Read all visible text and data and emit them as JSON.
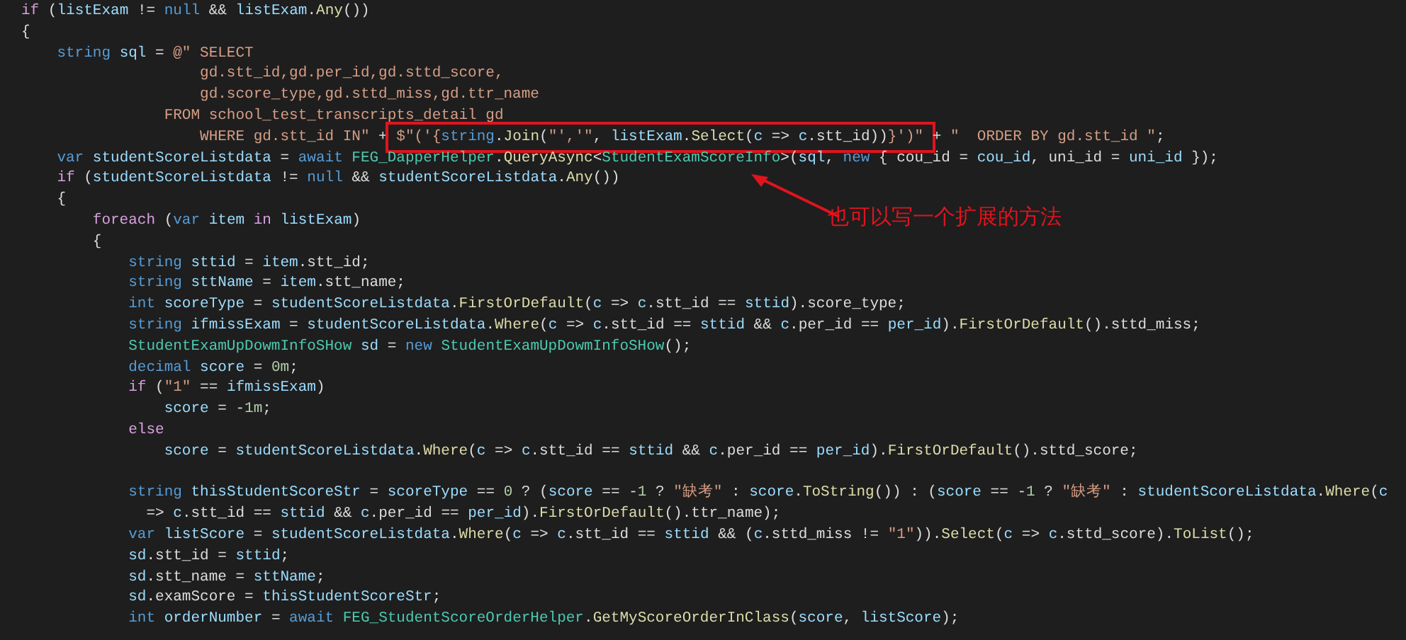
{
  "code_lines": [
    {
      "kind": "code",
      "tokens": [
        {
          "kind": "ctl",
          "t": "if"
        },
        {
          "kind": "p",
          "t": " ("
        },
        {
          "kind": "id",
          "t": "listExam"
        },
        {
          "kind": "p",
          "t": " != "
        },
        {
          "kind": "kw",
          "t": "null"
        },
        {
          "kind": "p",
          "t": " && "
        },
        {
          "kind": "id",
          "t": "listExam"
        },
        {
          "kind": "p",
          "t": "."
        },
        {
          "kind": "fn",
          "t": "Any"
        },
        {
          "kind": "p",
          "t": "())"
        }
      ]
    },
    {
      "kind": "code",
      "tokens": [
        {
          "kind": "p",
          "t": "{"
        }
      ]
    },
    {
      "kind": "code",
      "tokens": [
        {
          "kind": "kw",
          "t": "    string "
        },
        {
          "kind": "id",
          "t": "sql"
        },
        {
          "kind": "p",
          "t": " = "
        },
        {
          "kind": "str",
          "t": "@\" SELECT"
        }
      ]
    },
    {
      "kind": "code",
      "tokens": [
        {
          "kind": "str",
          "t": "                    gd.stt_id,gd.per_id,gd.sttd_score,"
        }
      ]
    },
    {
      "kind": "code",
      "tokens": [
        {
          "kind": "str",
          "t": "                    gd.score_type,gd.sttd_miss,gd.ttr_name"
        }
      ]
    },
    {
      "kind": "code",
      "tokens": [
        {
          "kind": "str",
          "t": "                FROM school_test_transcripts_detail gd"
        }
      ]
    },
    {
      "kind": "code",
      "tokens": [
        {
          "kind": "str",
          "t": "                    WHERE gd.stt_id IN\""
        },
        {
          "kind": "p",
          "t": " + "
        }
      ],
      "boxed_tokens": [
        {
          "kind": "str",
          "t": "$\"('{"
        },
        {
          "kind": "kw",
          "t": "string"
        },
        {
          "kind": "p",
          "t": "."
        },
        {
          "kind": "fn",
          "t": "Join"
        },
        {
          "kind": "p",
          "t": "("
        },
        {
          "kind": "str",
          "t": "\"','\""
        },
        {
          "kind": "p",
          "t": ", "
        },
        {
          "kind": "id",
          "t": "listExam"
        },
        {
          "kind": "p",
          "t": "."
        },
        {
          "kind": "fn",
          "t": "Select"
        },
        {
          "kind": "p",
          "t": "("
        },
        {
          "kind": "id",
          "t": "c"
        },
        {
          "kind": "p",
          "t": " => "
        },
        {
          "kind": "id",
          "t": "c"
        },
        {
          "kind": "p",
          "t": ".stt_id))"
        },
        {
          "kind": "str",
          "t": "}')\""
        }
      ],
      "tokens_after": [
        {
          "kind": "p",
          "t": " + "
        },
        {
          "kind": "str",
          "t": "\"  ORDER BY gd.stt_id \""
        },
        {
          "kind": "p",
          "t": ";"
        }
      ]
    },
    {
      "kind": "code",
      "tokens": [
        {
          "kind": "kw",
          "t": "    var "
        },
        {
          "kind": "id",
          "t": "studentScoreListdata"
        },
        {
          "kind": "p",
          "t": " = "
        },
        {
          "kind": "kw",
          "t": "await "
        },
        {
          "kind": "type",
          "t": "FEG_DapperHelper"
        },
        {
          "kind": "p",
          "t": "."
        },
        {
          "kind": "fn",
          "t": "QueryAsync"
        },
        {
          "kind": "p",
          "t": "<"
        },
        {
          "kind": "type",
          "t": "StudentExamScoreInfo"
        },
        {
          "kind": "p",
          "t": ">("
        },
        {
          "kind": "id",
          "t": "sql"
        },
        {
          "kind": "p",
          "t": ", "
        },
        {
          "kind": "kw",
          "t": "new"
        },
        {
          "kind": "p",
          "t": " { cou_id = "
        },
        {
          "kind": "id",
          "t": "cou_id"
        },
        {
          "kind": "p",
          "t": ", uni_id = "
        },
        {
          "kind": "id",
          "t": "uni_id"
        },
        {
          "kind": "p",
          "t": " });"
        }
      ]
    },
    {
      "kind": "code",
      "tokens": [
        {
          "kind": "ctl",
          "t": "    if"
        },
        {
          "kind": "p",
          "t": " ("
        },
        {
          "kind": "id",
          "t": "studentScoreListdata"
        },
        {
          "kind": "p",
          "t": " != "
        },
        {
          "kind": "kw",
          "t": "null"
        },
        {
          "kind": "p",
          "t": " && "
        },
        {
          "kind": "id",
          "t": "studentScoreListdata"
        },
        {
          "kind": "p",
          "t": "."
        },
        {
          "kind": "fn",
          "t": "Any"
        },
        {
          "kind": "p",
          "t": "())"
        }
      ]
    },
    {
      "kind": "code",
      "tokens": [
        {
          "kind": "p",
          "t": "    {"
        }
      ]
    },
    {
      "kind": "code",
      "tokens": [
        {
          "kind": "ctl",
          "t": "        foreach"
        },
        {
          "kind": "p",
          "t": " ("
        },
        {
          "kind": "kw",
          "t": "var "
        },
        {
          "kind": "id",
          "t": "item "
        },
        {
          "kind": "ctl",
          "t": "in "
        },
        {
          "kind": "id",
          "t": "listExam"
        },
        {
          "kind": "p",
          "t": ")"
        }
      ]
    },
    {
      "kind": "code",
      "tokens": [
        {
          "kind": "p",
          "t": "        {"
        }
      ]
    },
    {
      "kind": "code",
      "tokens": [
        {
          "kind": "kw",
          "t": "            string "
        },
        {
          "kind": "id",
          "t": "sttid"
        },
        {
          "kind": "p",
          "t": " = "
        },
        {
          "kind": "id",
          "t": "item"
        },
        {
          "kind": "p",
          "t": ".stt_id;"
        }
      ]
    },
    {
      "kind": "code",
      "tokens": [
        {
          "kind": "kw",
          "t": "            string "
        },
        {
          "kind": "id",
          "t": "sttName"
        },
        {
          "kind": "p",
          "t": " = "
        },
        {
          "kind": "id",
          "t": "item"
        },
        {
          "kind": "p",
          "t": ".stt_name;"
        }
      ]
    },
    {
      "kind": "code",
      "tokens": [
        {
          "kind": "kw",
          "t": "            int "
        },
        {
          "kind": "id",
          "t": "scoreType"
        },
        {
          "kind": "p",
          "t": " = "
        },
        {
          "kind": "id",
          "t": "studentScoreListdata"
        },
        {
          "kind": "p",
          "t": "."
        },
        {
          "kind": "fn",
          "t": "FirstOrDefault"
        },
        {
          "kind": "p",
          "t": "("
        },
        {
          "kind": "id",
          "t": "c"
        },
        {
          "kind": "p",
          "t": " => "
        },
        {
          "kind": "id",
          "t": "c"
        },
        {
          "kind": "p",
          "t": ".stt_id == "
        },
        {
          "kind": "id",
          "t": "sttid"
        },
        {
          "kind": "p",
          "t": ").score_type;"
        }
      ]
    },
    {
      "kind": "code",
      "tokens": [
        {
          "kind": "kw",
          "t": "            string "
        },
        {
          "kind": "id",
          "t": "ifmissExam"
        },
        {
          "kind": "p",
          "t": " = "
        },
        {
          "kind": "id",
          "t": "studentScoreListdata"
        },
        {
          "kind": "p",
          "t": "."
        },
        {
          "kind": "fn",
          "t": "Where"
        },
        {
          "kind": "p",
          "t": "("
        },
        {
          "kind": "id",
          "t": "c"
        },
        {
          "kind": "p",
          "t": " => "
        },
        {
          "kind": "id",
          "t": "c"
        },
        {
          "kind": "p",
          "t": ".stt_id == "
        },
        {
          "kind": "id",
          "t": "sttid"
        },
        {
          "kind": "p",
          "t": " && "
        },
        {
          "kind": "id",
          "t": "c"
        },
        {
          "kind": "p",
          "t": ".per_id == "
        },
        {
          "kind": "id",
          "t": "per_id"
        },
        {
          "kind": "p",
          "t": ")."
        },
        {
          "kind": "fn",
          "t": "FirstOrDefault"
        },
        {
          "kind": "p",
          "t": "().sttd_miss;"
        }
      ]
    },
    {
      "kind": "code",
      "tokens": [
        {
          "kind": "type",
          "t": "            StudentExamUpDowmInfoSHow "
        },
        {
          "kind": "id",
          "t": "sd"
        },
        {
          "kind": "p",
          "t": " = "
        },
        {
          "kind": "kw",
          "t": "new "
        },
        {
          "kind": "type",
          "t": "StudentExamUpDowmInfoSHow"
        },
        {
          "kind": "p",
          "t": "();"
        }
      ]
    },
    {
      "kind": "code",
      "tokens": [
        {
          "kind": "kw",
          "t": "            decimal "
        },
        {
          "kind": "id",
          "t": "score"
        },
        {
          "kind": "p",
          "t": " = "
        },
        {
          "kind": "num",
          "t": "0m"
        },
        {
          "kind": "p",
          "t": ";"
        }
      ]
    },
    {
      "kind": "code",
      "tokens": [
        {
          "kind": "ctl",
          "t": "            if"
        },
        {
          "kind": "p",
          "t": " ("
        },
        {
          "kind": "str",
          "t": "\"1\""
        },
        {
          "kind": "p",
          "t": " == "
        },
        {
          "kind": "id",
          "t": "ifmissExam"
        },
        {
          "kind": "p",
          "t": ")"
        }
      ]
    },
    {
      "kind": "code",
      "tokens": [
        {
          "kind": "id",
          "t": "                score"
        },
        {
          "kind": "p",
          "t": " = -"
        },
        {
          "kind": "num",
          "t": "1m"
        },
        {
          "kind": "p",
          "t": ";"
        }
      ]
    },
    {
      "kind": "code",
      "tokens": [
        {
          "kind": "ctl",
          "t": "            else"
        }
      ]
    },
    {
      "kind": "code",
      "tokens": [
        {
          "kind": "id",
          "t": "                score"
        },
        {
          "kind": "p",
          "t": " = "
        },
        {
          "kind": "id",
          "t": "studentScoreListdata"
        },
        {
          "kind": "p",
          "t": "."
        },
        {
          "kind": "fn",
          "t": "Where"
        },
        {
          "kind": "p",
          "t": "("
        },
        {
          "kind": "id",
          "t": "c"
        },
        {
          "kind": "p",
          "t": " => "
        },
        {
          "kind": "id",
          "t": "c"
        },
        {
          "kind": "p",
          "t": ".stt_id == "
        },
        {
          "kind": "id",
          "t": "sttid"
        },
        {
          "kind": "p",
          "t": " && "
        },
        {
          "kind": "id",
          "t": "c"
        },
        {
          "kind": "p",
          "t": ".per_id == "
        },
        {
          "kind": "id",
          "t": "per_id"
        },
        {
          "kind": "p",
          "t": ")."
        },
        {
          "kind": "fn",
          "t": "FirstOrDefault"
        },
        {
          "kind": "p",
          "t": "().sttd_score;"
        }
      ]
    },
    {
      "kind": "blank"
    },
    {
      "kind": "code",
      "tokens": [
        {
          "kind": "kw",
          "t": "            string "
        },
        {
          "kind": "id",
          "t": "thisStudentScoreStr"
        },
        {
          "kind": "p",
          "t": " = "
        },
        {
          "kind": "id",
          "t": "scoreType"
        },
        {
          "kind": "p",
          "t": " == "
        },
        {
          "kind": "num",
          "t": "0"
        },
        {
          "kind": "p",
          "t": " ? ("
        },
        {
          "kind": "id",
          "t": "score"
        },
        {
          "kind": "p",
          "t": " == -"
        },
        {
          "kind": "num",
          "t": "1"
        },
        {
          "kind": "p",
          "t": " ? "
        },
        {
          "kind": "str",
          "t": "\"缺考\""
        },
        {
          "kind": "p",
          "t": " : "
        },
        {
          "kind": "id",
          "t": "score"
        },
        {
          "kind": "p",
          "t": "."
        },
        {
          "kind": "fn",
          "t": "ToString"
        },
        {
          "kind": "p",
          "t": "()) : ("
        },
        {
          "kind": "id",
          "t": "score"
        },
        {
          "kind": "p",
          "t": " == -"
        },
        {
          "kind": "num",
          "t": "1"
        },
        {
          "kind": "p",
          "t": " ? "
        },
        {
          "kind": "str",
          "t": "\"缺考\""
        },
        {
          "kind": "p",
          "t": " : "
        },
        {
          "kind": "id",
          "t": "studentScoreListdata"
        },
        {
          "kind": "p",
          "t": "."
        },
        {
          "kind": "fn",
          "t": "Where"
        },
        {
          "kind": "p",
          "t": "("
        },
        {
          "kind": "id",
          "t": "c"
        }
      ]
    },
    {
      "kind": "code",
      "tokens": [
        {
          "kind": "p",
          "t": "              => "
        },
        {
          "kind": "id",
          "t": "c"
        },
        {
          "kind": "p",
          "t": ".stt_id == "
        },
        {
          "kind": "id",
          "t": "sttid"
        },
        {
          "kind": "p",
          "t": " && "
        },
        {
          "kind": "id",
          "t": "c"
        },
        {
          "kind": "p",
          "t": ".per_id == "
        },
        {
          "kind": "id",
          "t": "per_id"
        },
        {
          "kind": "p",
          "t": ")."
        },
        {
          "kind": "fn",
          "t": "FirstOrDefault"
        },
        {
          "kind": "p",
          "t": "().ttr_name);"
        }
      ]
    },
    {
      "kind": "code",
      "tokens": [
        {
          "kind": "kw",
          "t": "            var "
        },
        {
          "kind": "id",
          "t": "listScore"
        },
        {
          "kind": "p",
          "t": " = "
        },
        {
          "kind": "id",
          "t": "studentScoreListdata"
        },
        {
          "kind": "p",
          "t": "."
        },
        {
          "kind": "fn",
          "t": "Where"
        },
        {
          "kind": "p",
          "t": "("
        },
        {
          "kind": "id",
          "t": "c"
        },
        {
          "kind": "p",
          "t": " => "
        },
        {
          "kind": "id",
          "t": "c"
        },
        {
          "kind": "p",
          "t": ".stt_id == "
        },
        {
          "kind": "id",
          "t": "sttid"
        },
        {
          "kind": "p",
          "t": " && ("
        },
        {
          "kind": "id",
          "t": "c"
        },
        {
          "kind": "p",
          "t": ".sttd_miss != "
        },
        {
          "kind": "str",
          "t": "\"1\""
        },
        {
          "kind": "p",
          "t": "))."
        },
        {
          "kind": "fn",
          "t": "Select"
        },
        {
          "kind": "p",
          "t": "("
        },
        {
          "kind": "id",
          "t": "c"
        },
        {
          "kind": "p",
          "t": " => "
        },
        {
          "kind": "id",
          "t": "c"
        },
        {
          "kind": "p",
          "t": ".sttd_score)."
        },
        {
          "kind": "fn",
          "t": "ToList"
        },
        {
          "kind": "p",
          "t": "();"
        }
      ]
    },
    {
      "kind": "code",
      "tokens": [
        {
          "kind": "id",
          "t": "            sd"
        },
        {
          "kind": "p",
          "t": ".stt_id = "
        },
        {
          "kind": "id",
          "t": "sttid"
        },
        {
          "kind": "p",
          "t": ";"
        }
      ]
    },
    {
      "kind": "code",
      "tokens": [
        {
          "kind": "id",
          "t": "            sd"
        },
        {
          "kind": "p",
          "t": ".stt_name = "
        },
        {
          "kind": "id",
          "t": "sttName"
        },
        {
          "kind": "p",
          "t": ";"
        }
      ]
    },
    {
      "kind": "code",
      "tokens": [
        {
          "kind": "id",
          "t": "            sd"
        },
        {
          "kind": "p",
          "t": ".examScore = "
        },
        {
          "kind": "id",
          "t": "thisStudentScoreStr"
        },
        {
          "kind": "p",
          "t": ";"
        }
      ]
    },
    {
      "kind": "code",
      "tokens": [
        {
          "kind": "kw",
          "t": "            int "
        },
        {
          "kind": "id",
          "t": "orderNumber"
        },
        {
          "kind": "p",
          "t": " = "
        },
        {
          "kind": "kw",
          "t": "await "
        },
        {
          "kind": "type",
          "t": "FEG_StudentScoreOrderHelper"
        },
        {
          "kind": "p",
          "t": "."
        },
        {
          "kind": "fn",
          "t": "GetMyScoreOrderInClass"
        },
        {
          "kind": "p",
          "t": "("
        },
        {
          "kind": "id",
          "t": "score"
        },
        {
          "kind": "p",
          "t": ", "
        },
        {
          "kind": "id",
          "t": "listScore"
        },
        {
          "kind": "p",
          "t": ");"
        }
      ]
    }
  ],
  "annotation": {
    "text": "也可以写一个扩展的方法"
  }
}
